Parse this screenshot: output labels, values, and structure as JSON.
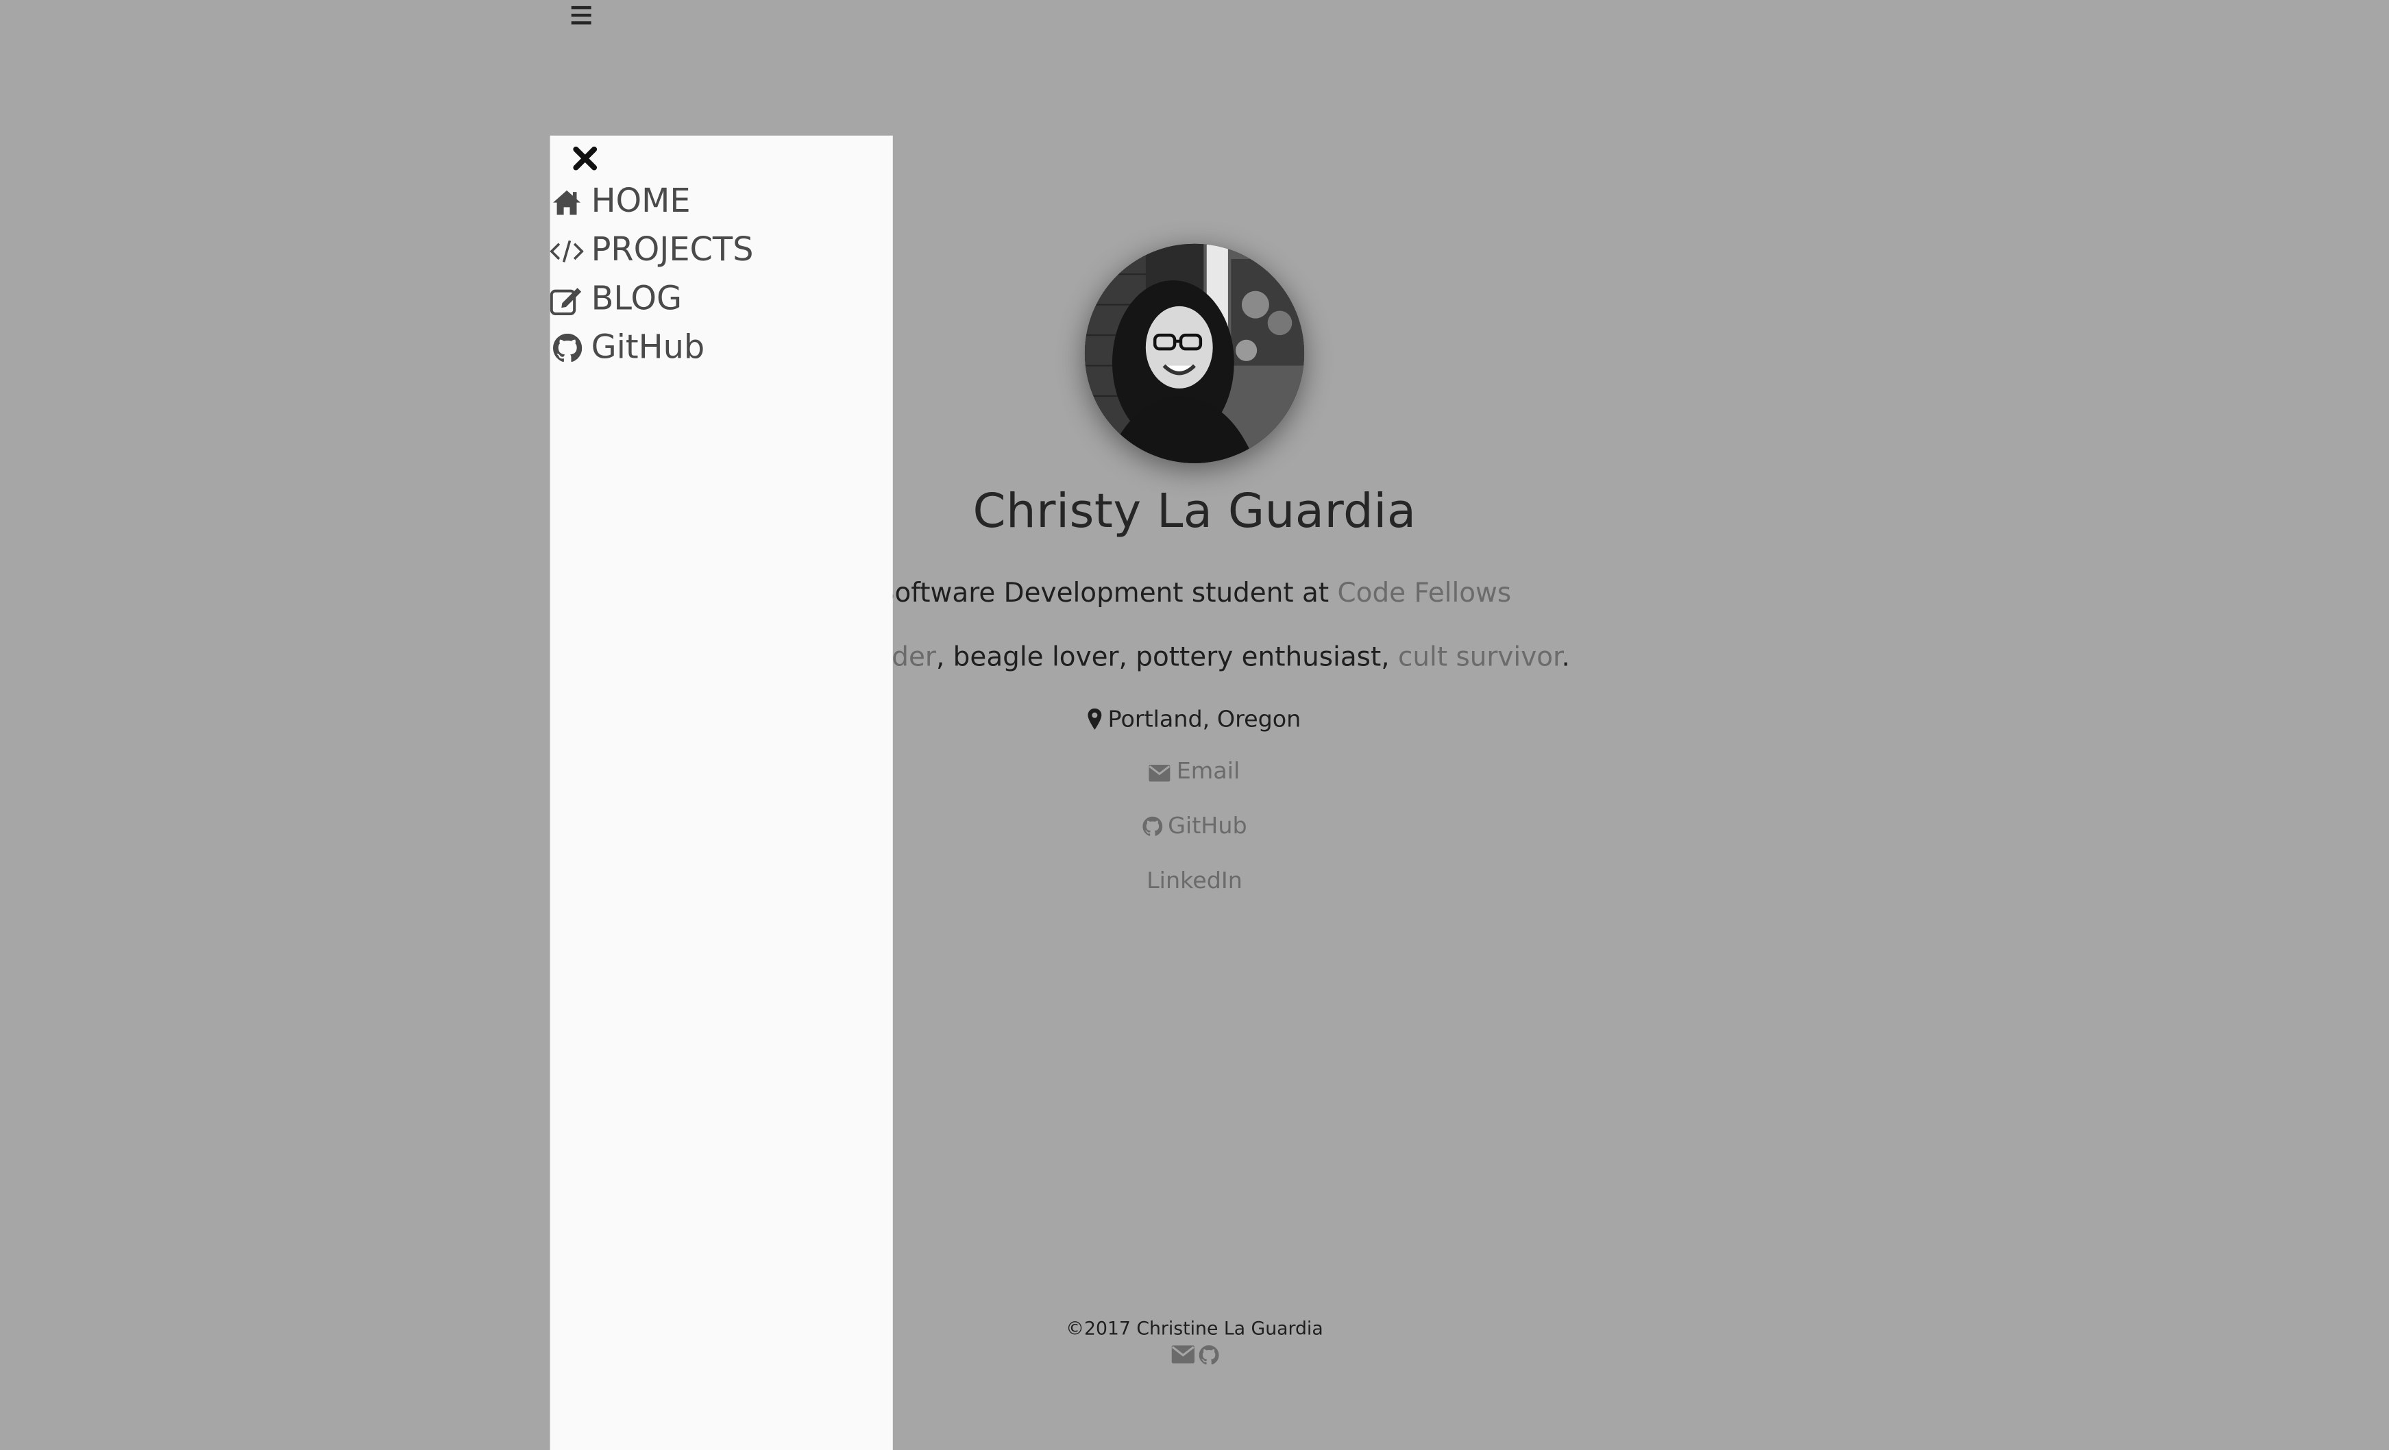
{
  "header": {
    "menu_icon": "hamburger-icon"
  },
  "profile": {
    "name": "Christy La Guardia",
    "line1_prefix": "Software Development student at ",
    "line1_link": "Code Fellows",
    "line2_link1": "be coder",
    "line2_middle": ", beagle lover, pottery enthusiast, ",
    "line2_link2": "cult survivor",
    "line2_suffix": ".",
    "location": "Portland, Oregon",
    "location_icon": "map-marker-icon"
  },
  "contacts": {
    "email": "Email",
    "github": "GitHub",
    "linkedin": "LinkedIn"
  },
  "footer": {
    "copyright": "©2017 Christine La Guardia"
  },
  "sidebar": {
    "close_icon": "close-icon",
    "items": [
      {
        "label": "HOME",
        "icon": "home-icon"
      },
      {
        "label": "PROJECTS",
        "icon": "code-icon"
      },
      {
        "label": "BLOG",
        "icon": "edit-icon"
      },
      {
        "label": "GitHub",
        "icon": "github-icon"
      }
    ]
  },
  "colors": {
    "overlay_background": "#a6a6a6",
    "sidebar_background": "#fafafa",
    "link_muted": "#6b6b6b",
    "text_dark": "#1f1f1f"
  }
}
